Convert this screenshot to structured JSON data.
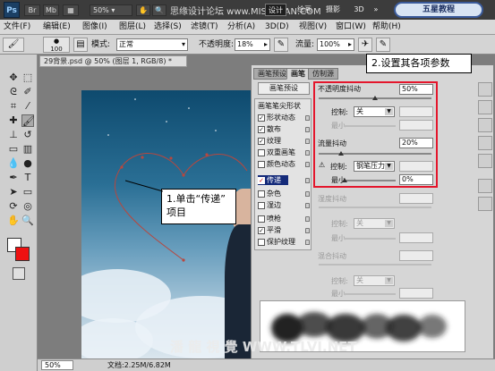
{
  "title_bar": {
    "app_icon": "Ps",
    "buttons": [
      "Br",
      "Mb"
    ],
    "zoom": "50%",
    "watermark": "思缘设计论坛 www.MISSYUAN.COM",
    "workspaces": [
      "设计",
      "绘画",
      "摄影",
      "3D",
      "»"
    ],
    "logo_badge": "五星教程"
  },
  "menu": [
    "文件(F)",
    "编辑(E)",
    "图像(I)",
    "图层(L)",
    "选择(S)",
    "滤镜(T)",
    "分析(A)",
    "3D(D)",
    "视图(V)",
    "窗口(W)",
    "帮助(H)"
  ],
  "options": {
    "brush_size": "100",
    "mode_label": "模式:",
    "mode_value": "正常",
    "opacity_label": "不透明度:",
    "opacity_value": "18%",
    "flow_label": "流量:",
    "flow_value": "100%"
  },
  "document": {
    "tab_title": "29背景.psd @ 50% (图层 1, RGB/8) *",
    "zoom": "50%",
    "doc_size": "文档:2.25M/6.82M",
    "watermark": "潘 龍 視 覺 WWW.TLVI.NET"
  },
  "callouts": {
    "step1_line1": "1.单击“传递”",
    "step1_line2": "项目",
    "step2": "2.设置其各项参数"
  },
  "panel": {
    "tabs": [
      "画笔预设",
      "画笔",
      "仿制源"
    ],
    "preset_button": "画笔预设",
    "tip_header": "画笔笔尖形状",
    "side_items": [
      {
        "label": "形状动态",
        "checked": true
      },
      {
        "label": "散布",
        "checked": true
      },
      {
        "label": "纹理",
        "checked": true
      },
      {
        "label": "双重画笔",
        "checked": false
      },
      {
        "label": "颜色动态",
        "checked": false
      },
      {
        "label": "传递",
        "checked": true,
        "selected": true
      },
      {
        "label": "杂色",
        "checked": false
      },
      {
        "label": "湿边",
        "checked": false
      },
      {
        "label": "喷枪",
        "checked": false
      },
      {
        "label": "平滑",
        "checked": true
      },
      {
        "label": "保护纹理",
        "checked": false
      }
    ],
    "opacity_jitter_label": "不透明度抖动",
    "opacity_jitter_value": "50%",
    "control_label": "控制:",
    "control_value_1": "关",
    "min_label": "最小",
    "flow_jitter_label": "流量抖动",
    "flow_jitter_value": "20%",
    "control_value_2": "钢笔压力",
    "min_value_2": "0%",
    "wetness_jitter_label": "湿度抖动",
    "mix_jitter_label": "混合抖动",
    "control_value_dim": "关"
  }
}
